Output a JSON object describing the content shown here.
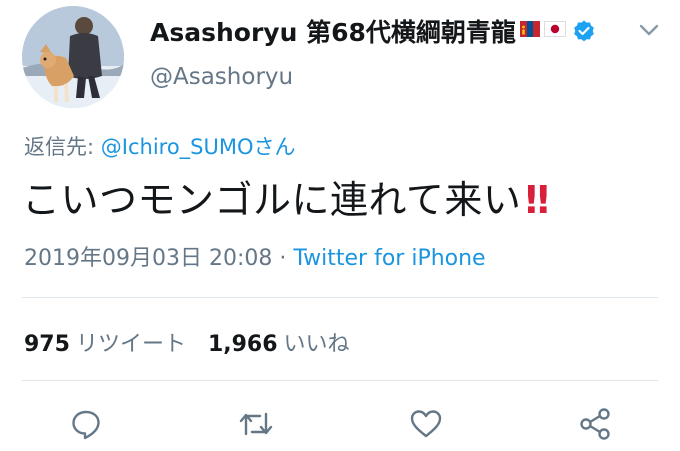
{
  "user": {
    "display_name": "Asashoryu 第68代横綱朝青龍",
    "handle": "@Asashoryu"
  },
  "reply": {
    "label": "返信先: ",
    "mention": "@Ichiro_SUMOさん"
  },
  "tweet": {
    "text": "こいつモンゴルに連れて来い",
    "emoji": "‼"
  },
  "meta": {
    "timestamp": "2019年09月03日 20:08",
    "separator": " · ",
    "source": "Twitter for iPhone"
  },
  "stats": {
    "retweets": "975",
    "retweets_label": "リツイート",
    "likes": "1,966",
    "likes_label": "いいね"
  },
  "colors": {
    "accent": "#1b95e0",
    "secondary_text": "#657786",
    "primary_text": "#14171a",
    "divider": "#e1e8ed",
    "exclamation": "#d9203a"
  },
  "icons": [
    "verified-badge-icon",
    "mongolia-flag-icon",
    "japan-flag-icon",
    "chevron-down-icon",
    "reply-icon",
    "retweet-icon",
    "like-icon",
    "share-icon"
  ]
}
